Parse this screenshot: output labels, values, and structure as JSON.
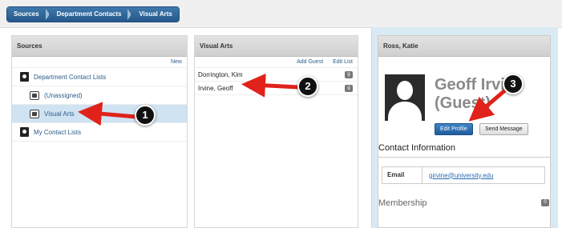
{
  "breadcrumb": [
    "Sources",
    "Department Contacts",
    "Visual Arts"
  ],
  "sources": {
    "title": "Sources",
    "new_label": "New",
    "items": [
      {
        "label": "Department Contact Lists",
        "icon": "address-book-icon"
      },
      {
        "label": "(Unassigned)",
        "icon": "contact-list-icon"
      },
      {
        "label": "Visual Arts",
        "icon": "contact-list-icon"
      },
      {
        "label": "My Contact Lists",
        "icon": "address-book-icon"
      }
    ]
  },
  "contacts": {
    "title": "Visual Arts",
    "add_guest_label": "Add Guest",
    "edit_list_label": "Edit List",
    "rows": [
      {
        "name": "Dorrington, Kim",
        "badge": "g"
      },
      {
        "name": "Irvine, Geoff",
        "badge": "g"
      }
    ]
  },
  "profile": {
    "title": "Ross, Katie",
    "name_line1": "Geoff Irvi",
    "name_line2": "(Guest)",
    "edit_profile_label": "Edit Profile",
    "send_message_label": "Send Message",
    "contact_info_label": "Contact Information",
    "email_label": "Email",
    "email_value": "girvine@university.edu",
    "membership_label": "Membership",
    "membership_count": "0"
  },
  "annotations": [
    "1",
    "2",
    "3"
  ],
  "colors": {
    "accent": "#25578a",
    "arrow": "#e0221b"
  }
}
